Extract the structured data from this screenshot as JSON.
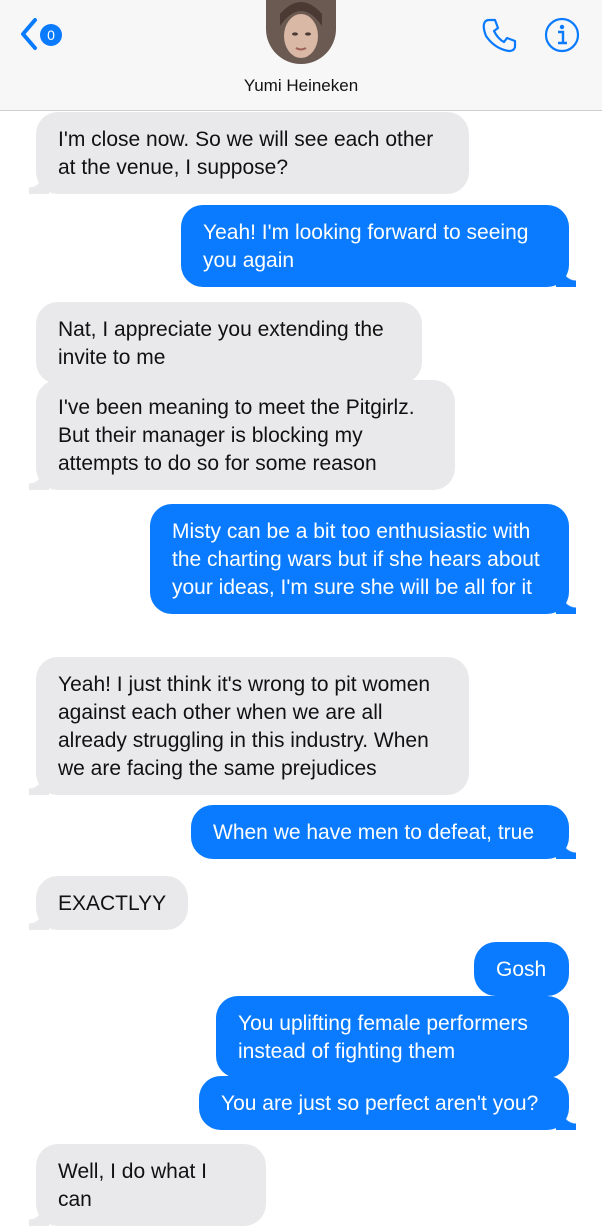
{
  "header": {
    "back_badge_count": "0",
    "contact_name": "Yumi Heineken",
    "accent_color": "#0a7bfe"
  },
  "messages": [
    {
      "from": "them",
      "text": "I'm close now. So we will see each other at the venue, I suppose?"
    },
    {
      "from": "me",
      "text": "Yeah! I'm looking forward to seeing you again"
    },
    {
      "from": "them",
      "text": "Nat, I appreciate you extending the invite to me"
    },
    {
      "from": "them",
      "text": "I've been meaning to meet the Pitgirlz. But their manager is blocking my attempts to do so for some reason"
    },
    {
      "from": "me",
      "text": "Misty can be a bit too enthusiastic with the charting wars but if she hears about your ideas, I'm sure she will be all for it"
    },
    {
      "from": "them",
      "text": "Yeah! I just think it's wrong to pit women against each other when we are all already struggling in this industry. When we are facing the same prejudices"
    },
    {
      "from": "me",
      "text": "When we have men to defeat, true"
    },
    {
      "from": "them",
      "text": "EXACTLYY"
    },
    {
      "from": "me",
      "text": "Gosh"
    },
    {
      "from": "me",
      "text": "You uplifting female performers instead of fighting them"
    },
    {
      "from": "me",
      "text": "You are just so perfect aren't you?"
    },
    {
      "from": "them",
      "text": "Well, I do what I can"
    }
  ]
}
